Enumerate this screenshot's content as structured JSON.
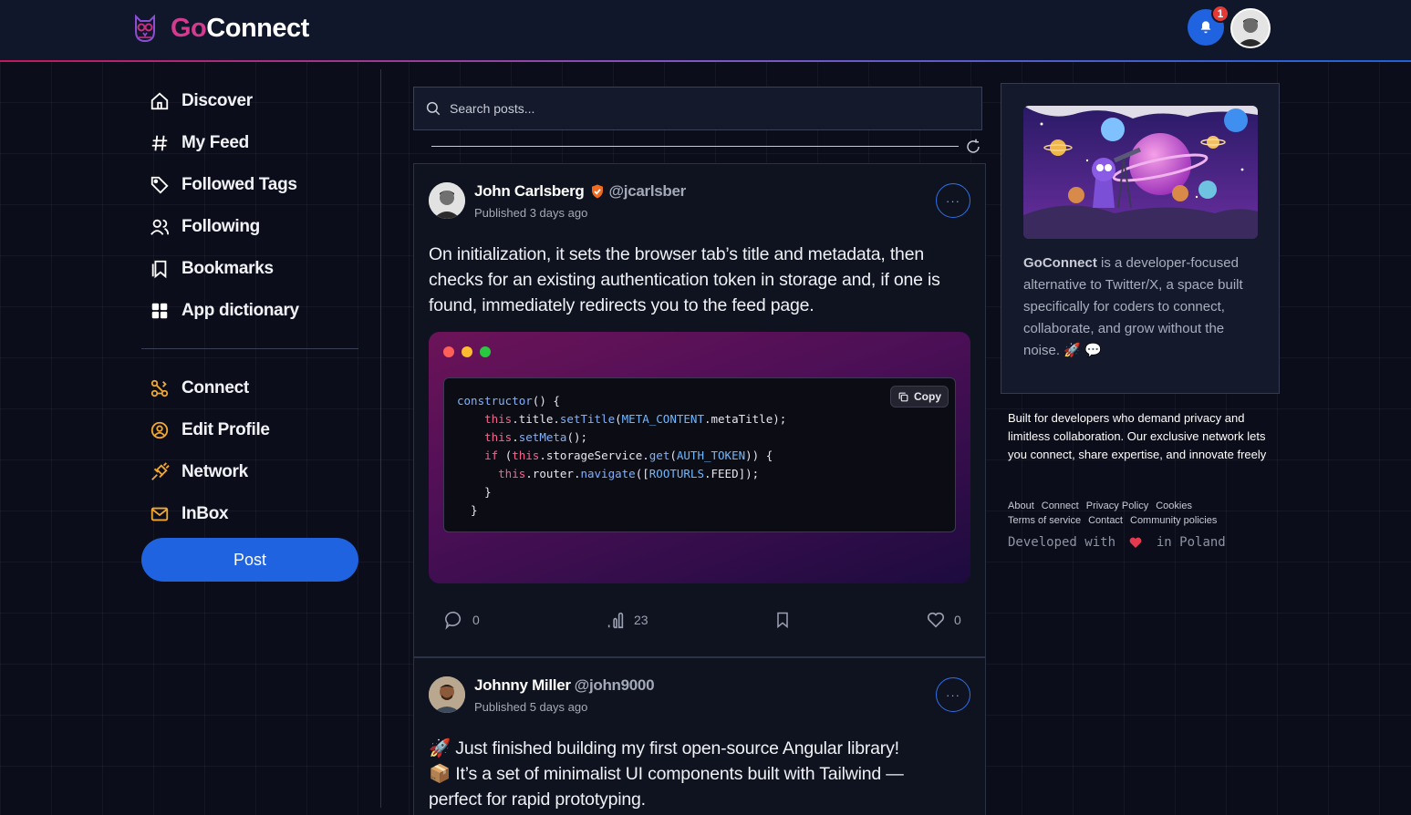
{
  "header": {
    "logo_go": "Go",
    "logo_connect": "Connect",
    "notification_count": "1"
  },
  "sidebar": {
    "items": [
      {
        "label": "Discover",
        "icon": "home-icon"
      },
      {
        "label": "My Feed",
        "icon": "hash-icon"
      },
      {
        "label": "Followed Tags",
        "icon": "tag-icon"
      },
      {
        "label": "Following",
        "icon": "users-icon"
      },
      {
        "label": "Bookmarks",
        "icon": "bookmark-icon"
      },
      {
        "label": "App dictionary",
        "icon": "grid-icon"
      }
    ],
    "secondary_items": [
      {
        "label": "Connect",
        "icon": "connect-icon"
      },
      {
        "label": "Edit Profile",
        "icon": "profile-icon"
      },
      {
        "label": "Network",
        "icon": "plug-icon"
      },
      {
        "label": "InBox",
        "icon": "mail-icon"
      }
    ],
    "post_label": "Post"
  },
  "search": {
    "placeholder": "Search posts..."
  },
  "posts": [
    {
      "author": "John Carlsberg",
      "handle": "@jcarlsber",
      "published": "Published 3 days ago",
      "verified": true,
      "body": "On initialization, it sets the browser tab’s title and metadata, then checks for an existing authentication token in storage and, if one is found, immediately redirects you to the feed page.",
      "copy_label": "Copy",
      "stats": {
        "comments": "0",
        "views": "23",
        "likes": "0"
      }
    },
    {
      "author": "Johnny Miller",
      "handle": "@john9000",
      "published": "Published 5 days ago",
      "line1": "🚀 Just finished building my first open-source Angular library!",
      "line2": "📦 It’s a set of minimalist UI components built with Tailwind —",
      "line3": "perfect for rapid prototyping."
    }
  ],
  "about": {
    "brand": "GoConnect",
    "text": " is a developer-focused alternative to Twitter/X, a space built specifically for coders to connect, collaborate, and grow without the noise. 🚀 💬"
  },
  "side_description": "Built for developers who demand privacy and limitless collaboration. Our exclusive network lets you connect, share expertise, and innovate freely",
  "footer": {
    "links_row1": [
      "About",
      "Connect",
      "Privacy Policy",
      "Cookies"
    ],
    "links_row2": [
      "Terms of service",
      "Contact",
      "Community policies"
    ],
    "developed_with": "Developed with",
    "in_poland": " in Poland"
  },
  "colors": {
    "accent": "#1f63e0",
    "brand_pink": "#d43a8e",
    "background": "#0b0d1a"
  }
}
